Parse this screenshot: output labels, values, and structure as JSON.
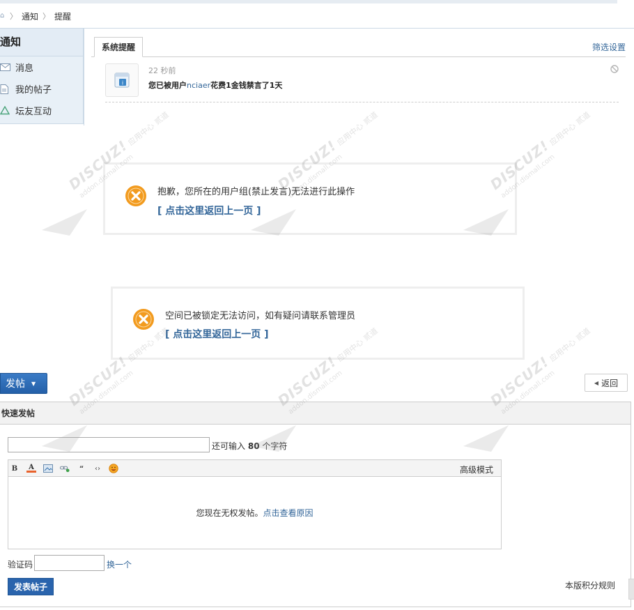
{
  "breadcrumb": {
    "home_icon": "home-icon",
    "items": [
      "通知",
      "提醒"
    ]
  },
  "sidenav": {
    "title": "通知",
    "items": [
      {
        "label": "消息",
        "icon": "envelope-icon"
      },
      {
        "label": "我的帖子",
        "icon": "document-icon"
      },
      {
        "label": "坛友互动",
        "icon": "recycle-icon"
      }
    ]
  },
  "notices": {
    "active_tab": "系统提醒",
    "filter_link": "筛选设置",
    "item": {
      "time": "22 秒前",
      "text_prefix": "您已被用户",
      "user": "nciaer",
      "text_suffix": "花费1金钱禁言了1天"
    }
  },
  "errors": [
    {
      "message": "抱歉，您所在的用户组(禁止发言)无法进行此操作",
      "back_link": "[ 点击这里返回上一页 ]"
    },
    {
      "message": "空间已被锁定无法访问，如有疑问请联系管理员",
      "back_link": "[ 点击这里返回上一页 ]"
    }
  ],
  "toolbar": {
    "post_label": "发帖",
    "back_label": "返回"
  },
  "quick_post": {
    "header": "快速发帖",
    "title_value": "",
    "char_prefix": "还可输入",
    "char_count": "80",
    "char_suffix": "个字符",
    "editor_buttons": [
      "B",
      "A"
    ],
    "advanced_mode": "高级模式",
    "no_permission_text": "您现在无权发帖。",
    "no_permission_link": "点击查看原因",
    "captcha_label": "验证码",
    "captcha_value": "",
    "captcha_change": "换一个",
    "submit_label": "发表帖子",
    "rules_link": "本版积分规则"
  },
  "watermark": {
    "brand": "DISCUZ!",
    "cn_mid": "应用中心",
    "cn_main": "贰道",
    "domain": "addon.dismall.com"
  },
  "colors": {
    "link": "#336699",
    "button": "#2a64ad",
    "error_icon": "#f29b1f"
  }
}
